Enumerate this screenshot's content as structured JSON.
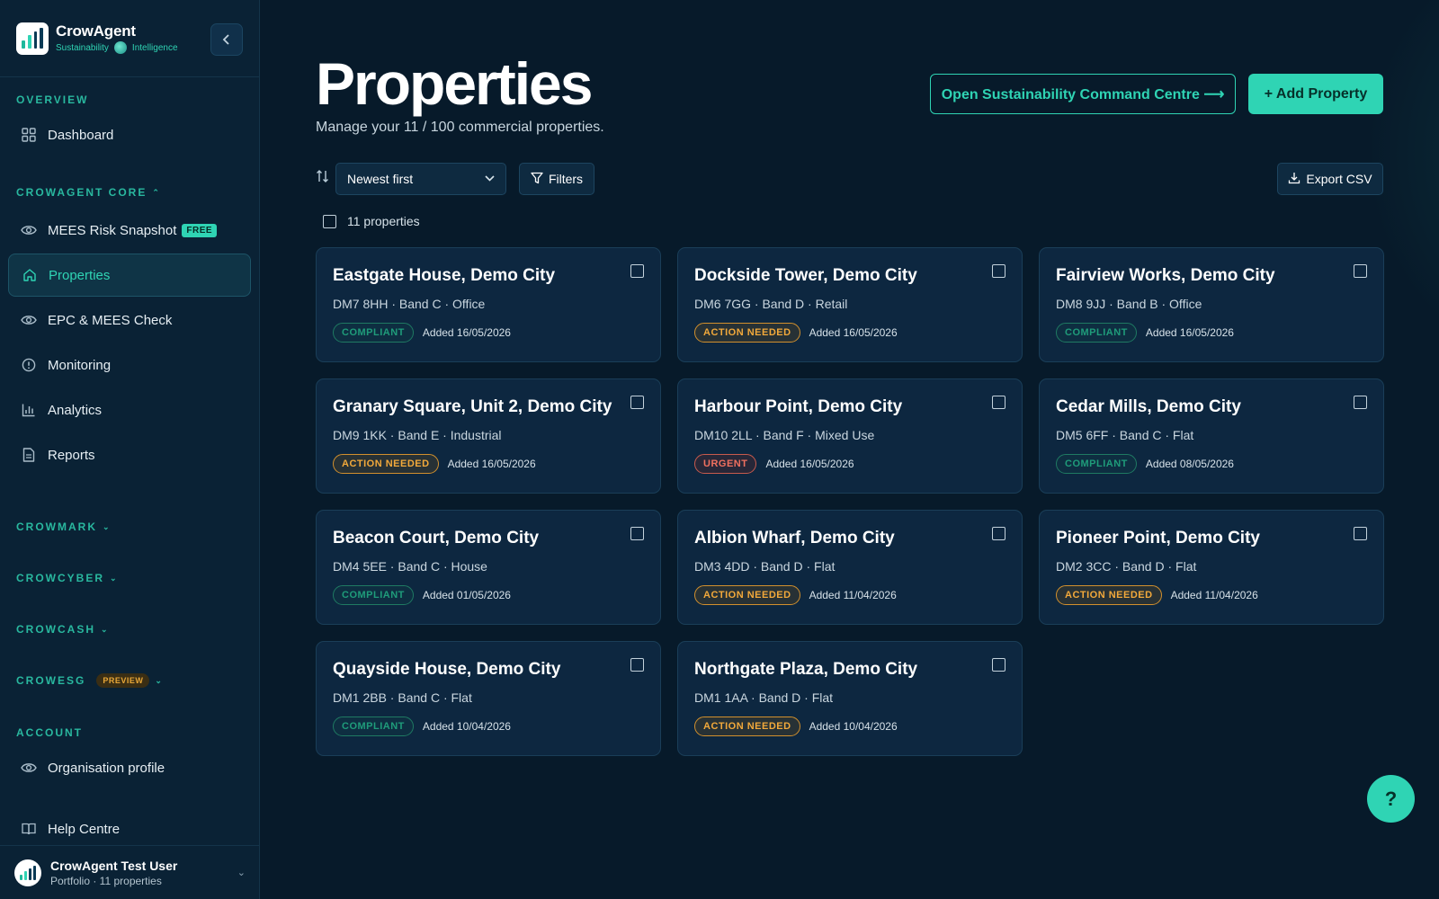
{
  "brand": {
    "name": "CrowAgent",
    "tag_left": "Sustainability",
    "tag_right": "Intelligence"
  },
  "sidebar": {
    "overview_label": "OVERVIEW",
    "dashboard": "Dashboard",
    "core_label": "CROWAGENT CORE",
    "mees_snapshot": "MEES Risk Snapshot",
    "free_badge": "FREE",
    "properties": "Properties",
    "epc_check": "EPC & MEES Check",
    "monitoring": "Monitoring",
    "analytics": "Analytics",
    "reports": "Reports",
    "crowmark": "CROWMARK",
    "crowcyber": "CROWCYBER",
    "crowcash": "CROWCASH",
    "crowesg": "CROWESG",
    "preview_badge": "PREVIEW",
    "account_label": "ACCOUNT",
    "org_profile": "Organisation profile",
    "help_centre": "Help Centre"
  },
  "user": {
    "name": "CrowAgent Test User",
    "sub": "Portfolio · 11 properties"
  },
  "header": {
    "title": "Properties",
    "subtitle": "Manage your 11 / 100 commercial properties.",
    "command_centre": "Open Sustainability Command Centre ⟶",
    "add_property": "+ Add Property"
  },
  "toolbar": {
    "sort_value": "Newest first",
    "filters": "Filters",
    "export": "Export CSV",
    "count": "11 properties"
  },
  "properties": [
    {
      "title": "Eastgate House, Demo City",
      "meta": "DM7 8HH · Band C · Office",
      "status": "COMPLIANT",
      "kind": "compliant",
      "added": "Added 16/05/2026"
    },
    {
      "title": "Dockside Tower, Demo City",
      "meta": "DM6 7GG · Band D · Retail",
      "status": "ACTION NEEDED",
      "kind": "action",
      "added": "Added 16/05/2026"
    },
    {
      "title": "Fairview Works, Demo City",
      "meta": "DM8 9JJ · Band B · Office",
      "status": "COMPLIANT",
      "kind": "compliant",
      "added": "Added 16/05/2026"
    },
    {
      "title": "Granary Square, Unit 2, Demo City",
      "meta": "DM9 1KK · Band E · Industrial",
      "status": "ACTION NEEDED",
      "kind": "action",
      "added": "Added 16/05/2026"
    },
    {
      "title": "Harbour Point, Demo City",
      "meta": "DM10 2LL · Band F · Mixed Use",
      "status": "URGENT",
      "kind": "urgent",
      "added": "Added 16/05/2026"
    },
    {
      "title": "Cedar Mills, Demo City",
      "meta": "DM5 6FF · Band C · Flat",
      "status": "COMPLIANT",
      "kind": "compliant",
      "added": "Added 08/05/2026"
    },
    {
      "title": "Beacon Court, Demo City",
      "meta": "DM4 5EE · Band C · House",
      "status": "COMPLIANT",
      "kind": "compliant",
      "added": "Added 01/05/2026"
    },
    {
      "title": "Albion Wharf, Demo City",
      "meta": "DM3 4DD · Band D · Flat",
      "status": "ACTION NEEDED",
      "kind": "action",
      "added": "Added 11/04/2026"
    },
    {
      "title": "Pioneer Point, Demo City",
      "meta": "DM2 3CC · Band D · Flat",
      "status": "ACTION NEEDED",
      "kind": "action",
      "added": "Added 11/04/2026"
    },
    {
      "title": "Quayside House, Demo City",
      "meta": "DM1 2BB · Band C · Flat",
      "status": "COMPLIANT",
      "kind": "compliant",
      "added": "Added 10/04/2026"
    },
    {
      "title": "Northgate Plaza, Demo City",
      "meta": "DM1 1AA · Band D · Flat",
      "status": "ACTION NEEDED",
      "kind": "action",
      "added": "Added 10/04/2026"
    }
  ],
  "help_fab": "?",
  "colors": {
    "accent": "#2fd4b4",
    "compliant": "#1f9c7a",
    "action": "#f2a93b",
    "urgent": "#f0705f",
    "background": "#071a2a"
  }
}
